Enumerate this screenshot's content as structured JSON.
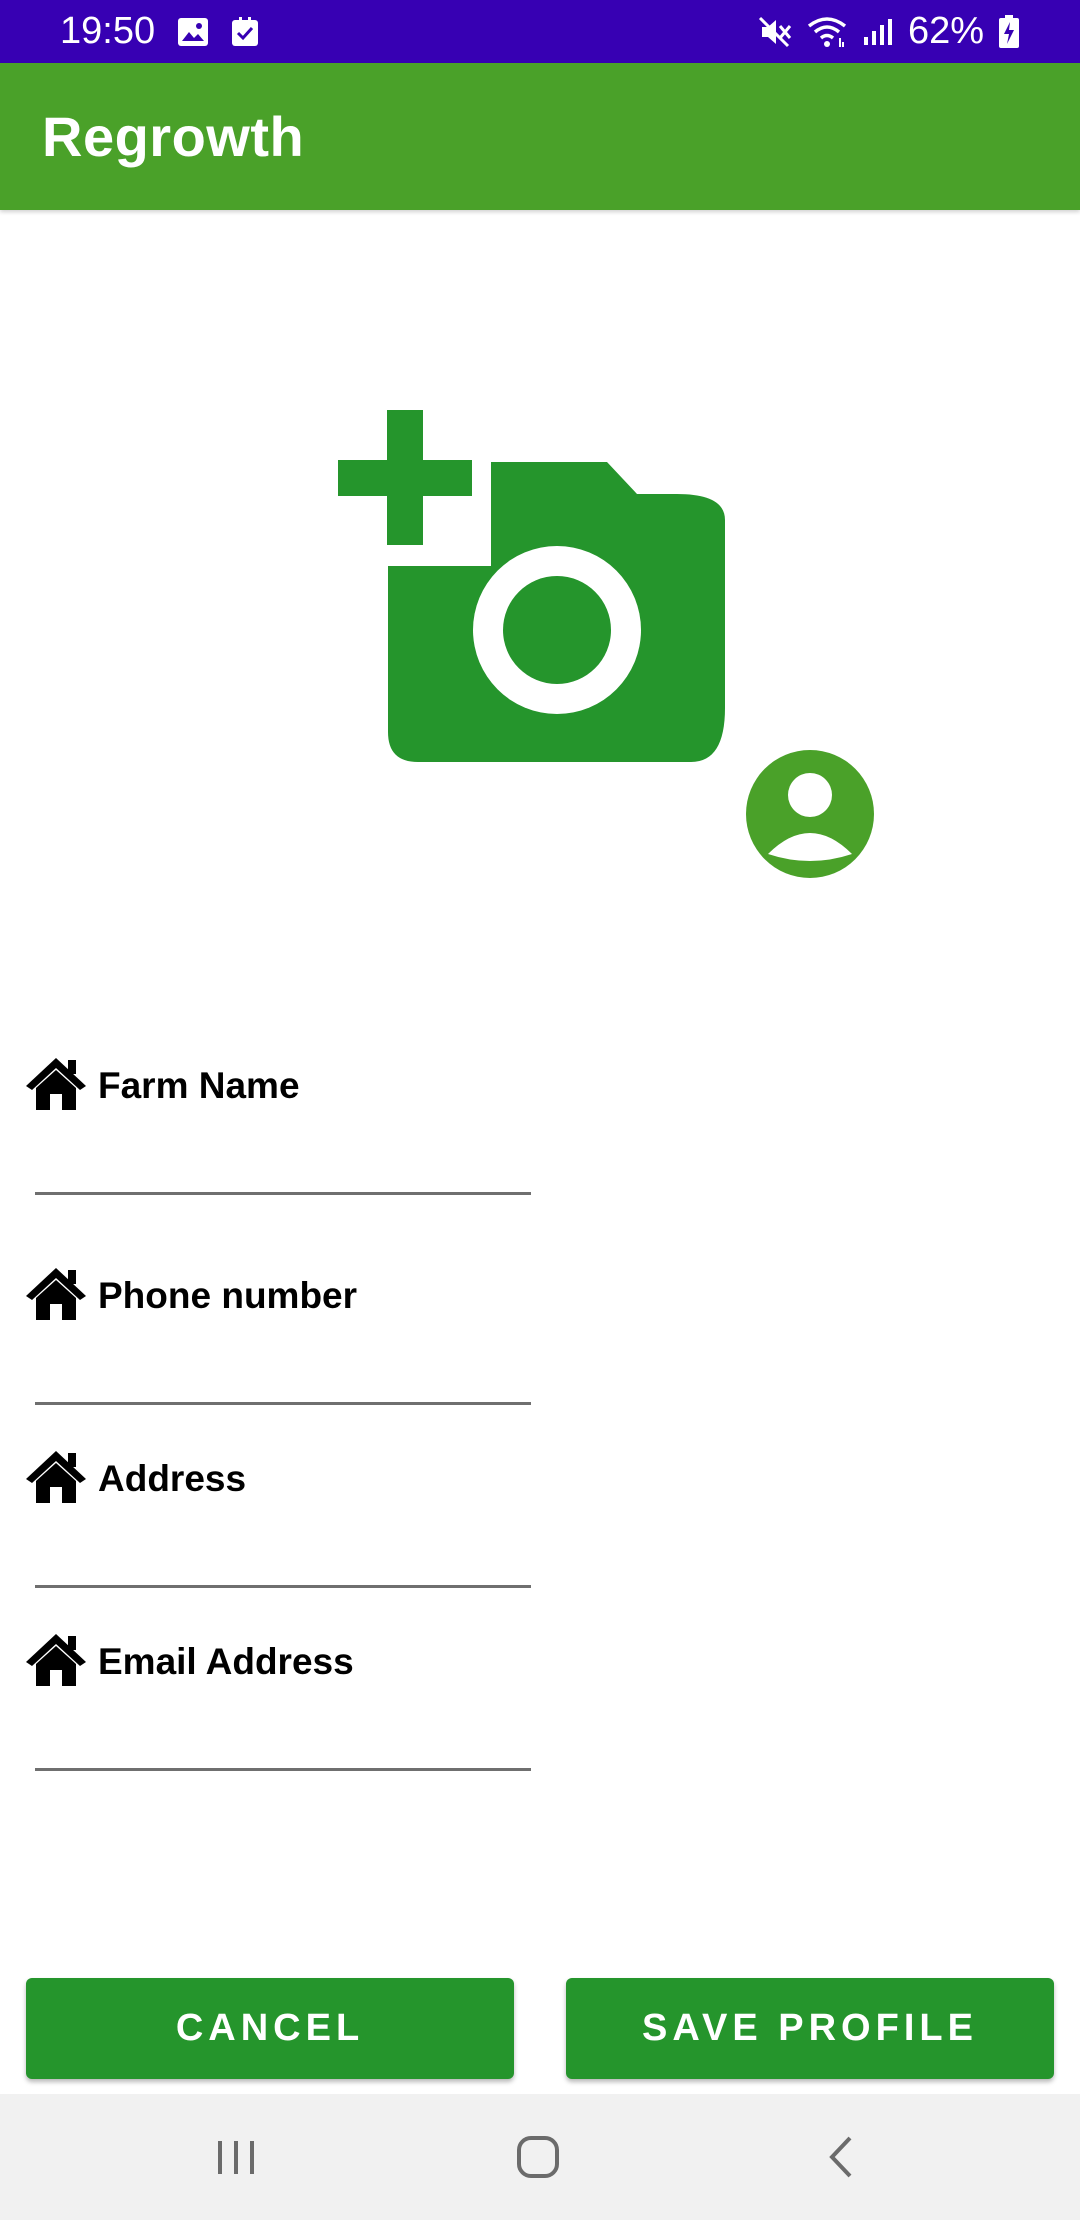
{
  "status_bar": {
    "time": "19:50",
    "left_icons": [
      "image-icon",
      "checkbox-icon"
    ],
    "right_icons": [
      "mute-icon",
      "wifi-icon",
      "signal-icon"
    ],
    "battery": "62%"
  },
  "app_bar": {
    "title": "Regrowth"
  },
  "profile": {
    "add_photo_icon": "add-a-photo-icon",
    "avatar_icon": "account-circle-icon"
  },
  "form": {
    "fields": [
      {
        "label": "Farm Name",
        "icon": "home-icon",
        "value": ""
      },
      {
        "label": "Phone number",
        "icon": "home-icon",
        "value": ""
      },
      {
        "label": "Address",
        "icon": "home-icon",
        "value": ""
      },
      {
        "label": "Email Address",
        "icon": "home-icon",
        "value": ""
      }
    ]
  },
  "actions": {
    "cancel_label": "CANCEL",
    "save_label": "SAVE PROFILE"
  },
  "nav": {
    "items": [
      "recents-icon",
      "home-circle-icon",
      "back-icon"
    ]
  },
  "colors": {
    "status_bar": "#3700b3",
    "app_bar": "#4aa129",
    "icon_green": "#25952c",
    "button_green": "#25952c",
    "nav_bar": "#f1f1f1"
  }
}
